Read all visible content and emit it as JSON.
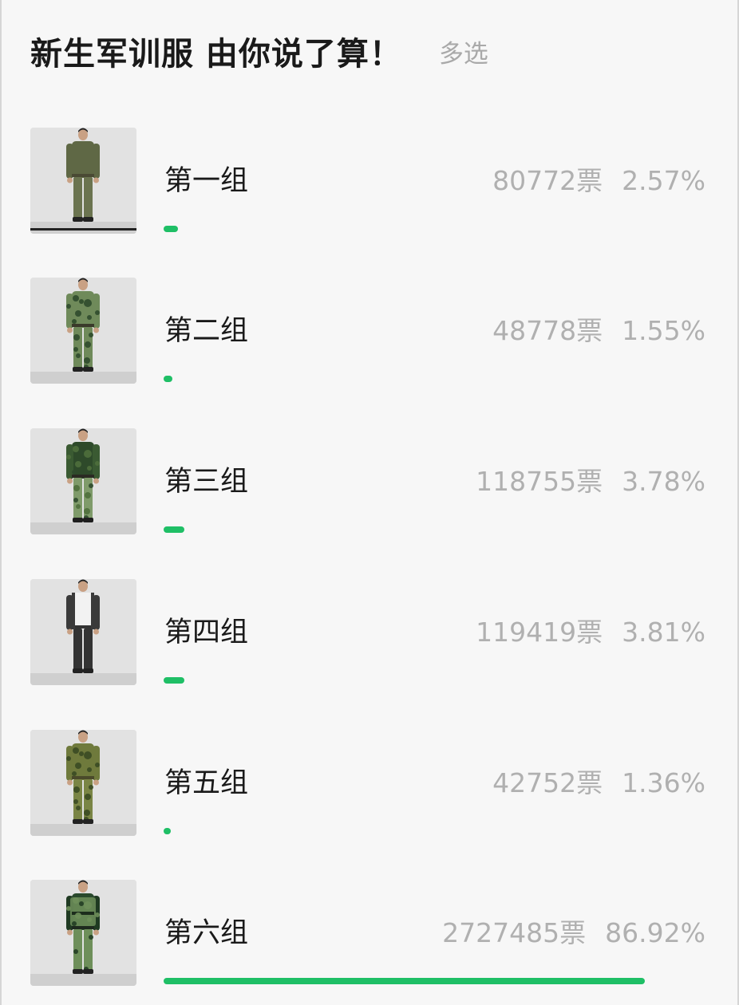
{
  "poll": {
    "title": "新生军训服 由你说了算！",
    "mode": "多选",
    "accent_color": "#1fbf66",
    "options": [
      {
        "label": "第一组",
        "votes": "80772票",
        "percent": "2.57%",
        "share": 0.0257,
        "uniform": "olive-solid"
      },
      {
        "label": "第二组",
        "votes": "48778票",
        "percent": "1.55%",
        "share": 0.0155,
        "uniform": "green-camo"
      },
      {
        "label": "第三组",
        "votes": "118755票",
        "percent": "3.78%",
        "share": 0.0378,
        "uniform": "dark-green-camo"
      },
      {
        "label": "第四组",
        "votes": "119419票",
        "percent": "3.81%",
        "share": 0.0381,
        "uniform": "white-black-jacket"
      },
      {
        "label": "第五组",
        "votes": "42752票",
        "percent": "1.36%",
        "share": 0.0136,
        "uniform": "woodland-camo"
      },
      {
        "label": "第六组",
        "votes": "2727485票",
        "percent": "86.92%",
        "share": 0.8692,
        "uniform": "forest-camo-vest"
      }
    ]
  }
}
